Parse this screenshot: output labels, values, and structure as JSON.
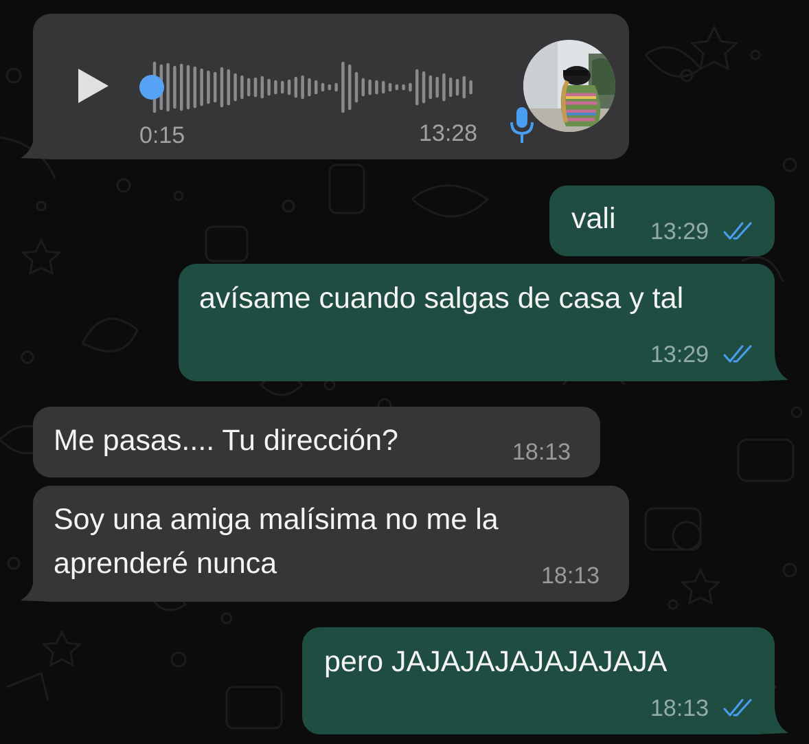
{
  "voice_note": {
    "duration": "0:15",
    "time": "13:28",
    "played_fraction": 0.0
  },
  "messages": [
    {
      "direction": "outgoing",
      "text": "vali",
      "time": "13:29",
      "status": "read-double-tick-icon"
    },
    {
      "direction": "outgoing",
      "text": "avísame cuando salgas de casa y tal",
      "time": "13:29",
      "status": "read-double-tick-icon"
    },
    {
      "direction": "incoming",
      "text": "Me pasas.... Tu dirección?",
      "time": "18:13"
    },
    {
      "direction": "incoming",
      "text": "Soy una amiga malísima no me la aprenderé nunca",
      "time": "18:13"
    },
    {
      "direction": "outgoing",
      "text": "pero JAJAJAJAJAJAJAJA",
      "time": "18:13",
      "status": "read-double-tick-icon"
    }
  ],
  "colors": {
    "background": "#0c0c0c",
    "incoming_bubble": "#363638",
    "outgoing_bubble": "#1f4d42",
    "read_tick": "#4a9ef2",
    "voice_accent": "#56a3f5"
  }
}
